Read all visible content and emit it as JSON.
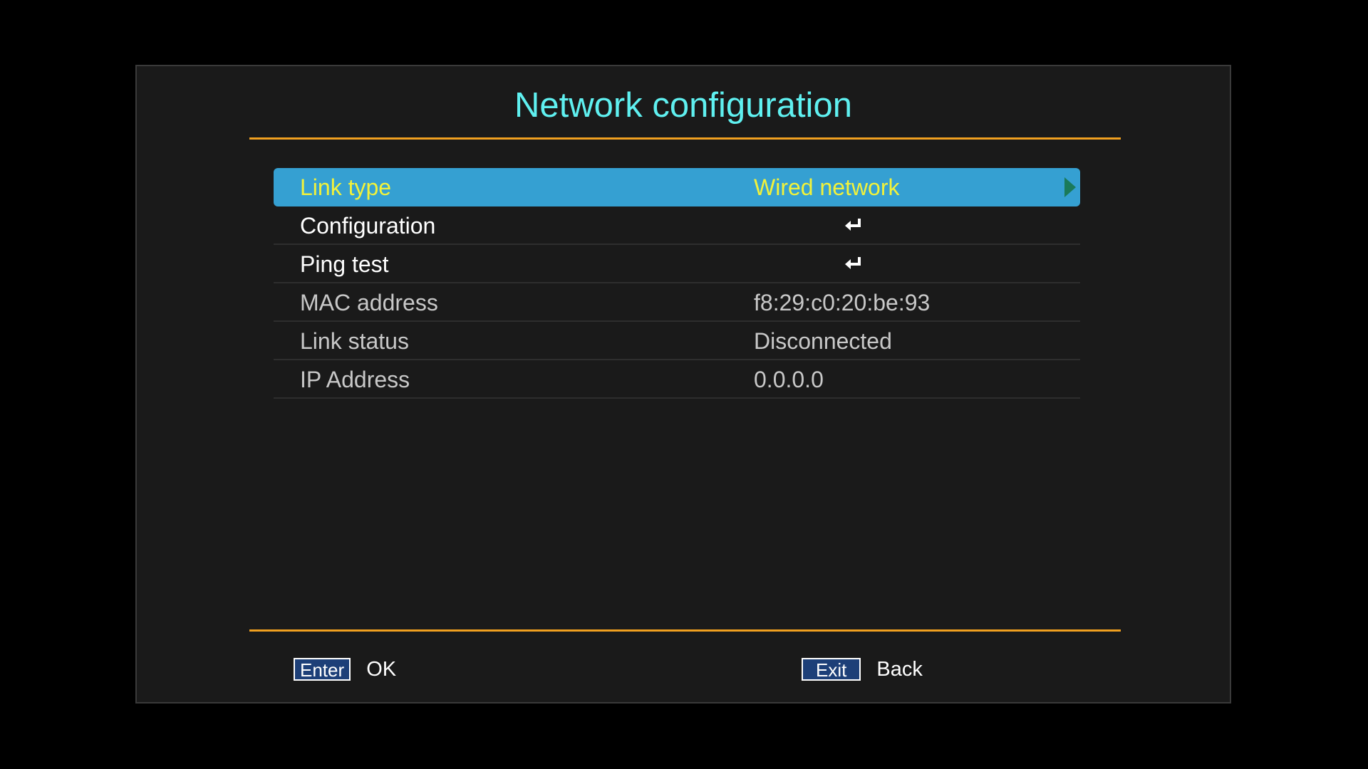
{
  "screen": {
    "title": "Network configuration"
  },
  "menu": {
    "items": [
      {
        "label": "Link type",
        "value": "Wired network",
        "icon": "chevron-right-icon"
      },
      {
        "label": "Configuration",
        "icon": "enter-return-icon"
      },
      {
        "label": "Ping test",
        "icon": "enter-return-icon"
      },
      {
        "label": "MAC address",
        "value": "f8:29:c0:20:be:93"
      },
      {
        "label": "Link status",
        "value": "Disconnected"
      },
      {
        "label": "IP Address",
        "value": "0.0.0.0"
      }
    ]
  },
  "footer": {
    "enter_key": "Enter",
    "enter_action": "OK",
    "exit_key": "Exit",
    "exit_action": "Back"
  },
  "colors": {
    "title": "#5ff0f0",
    "accent_rule": "#f0a020",
    "selection": "#35a0d2",
    "selected_text": "#f2f23a",
    "key_background": "#1d3f78"
  }
}
